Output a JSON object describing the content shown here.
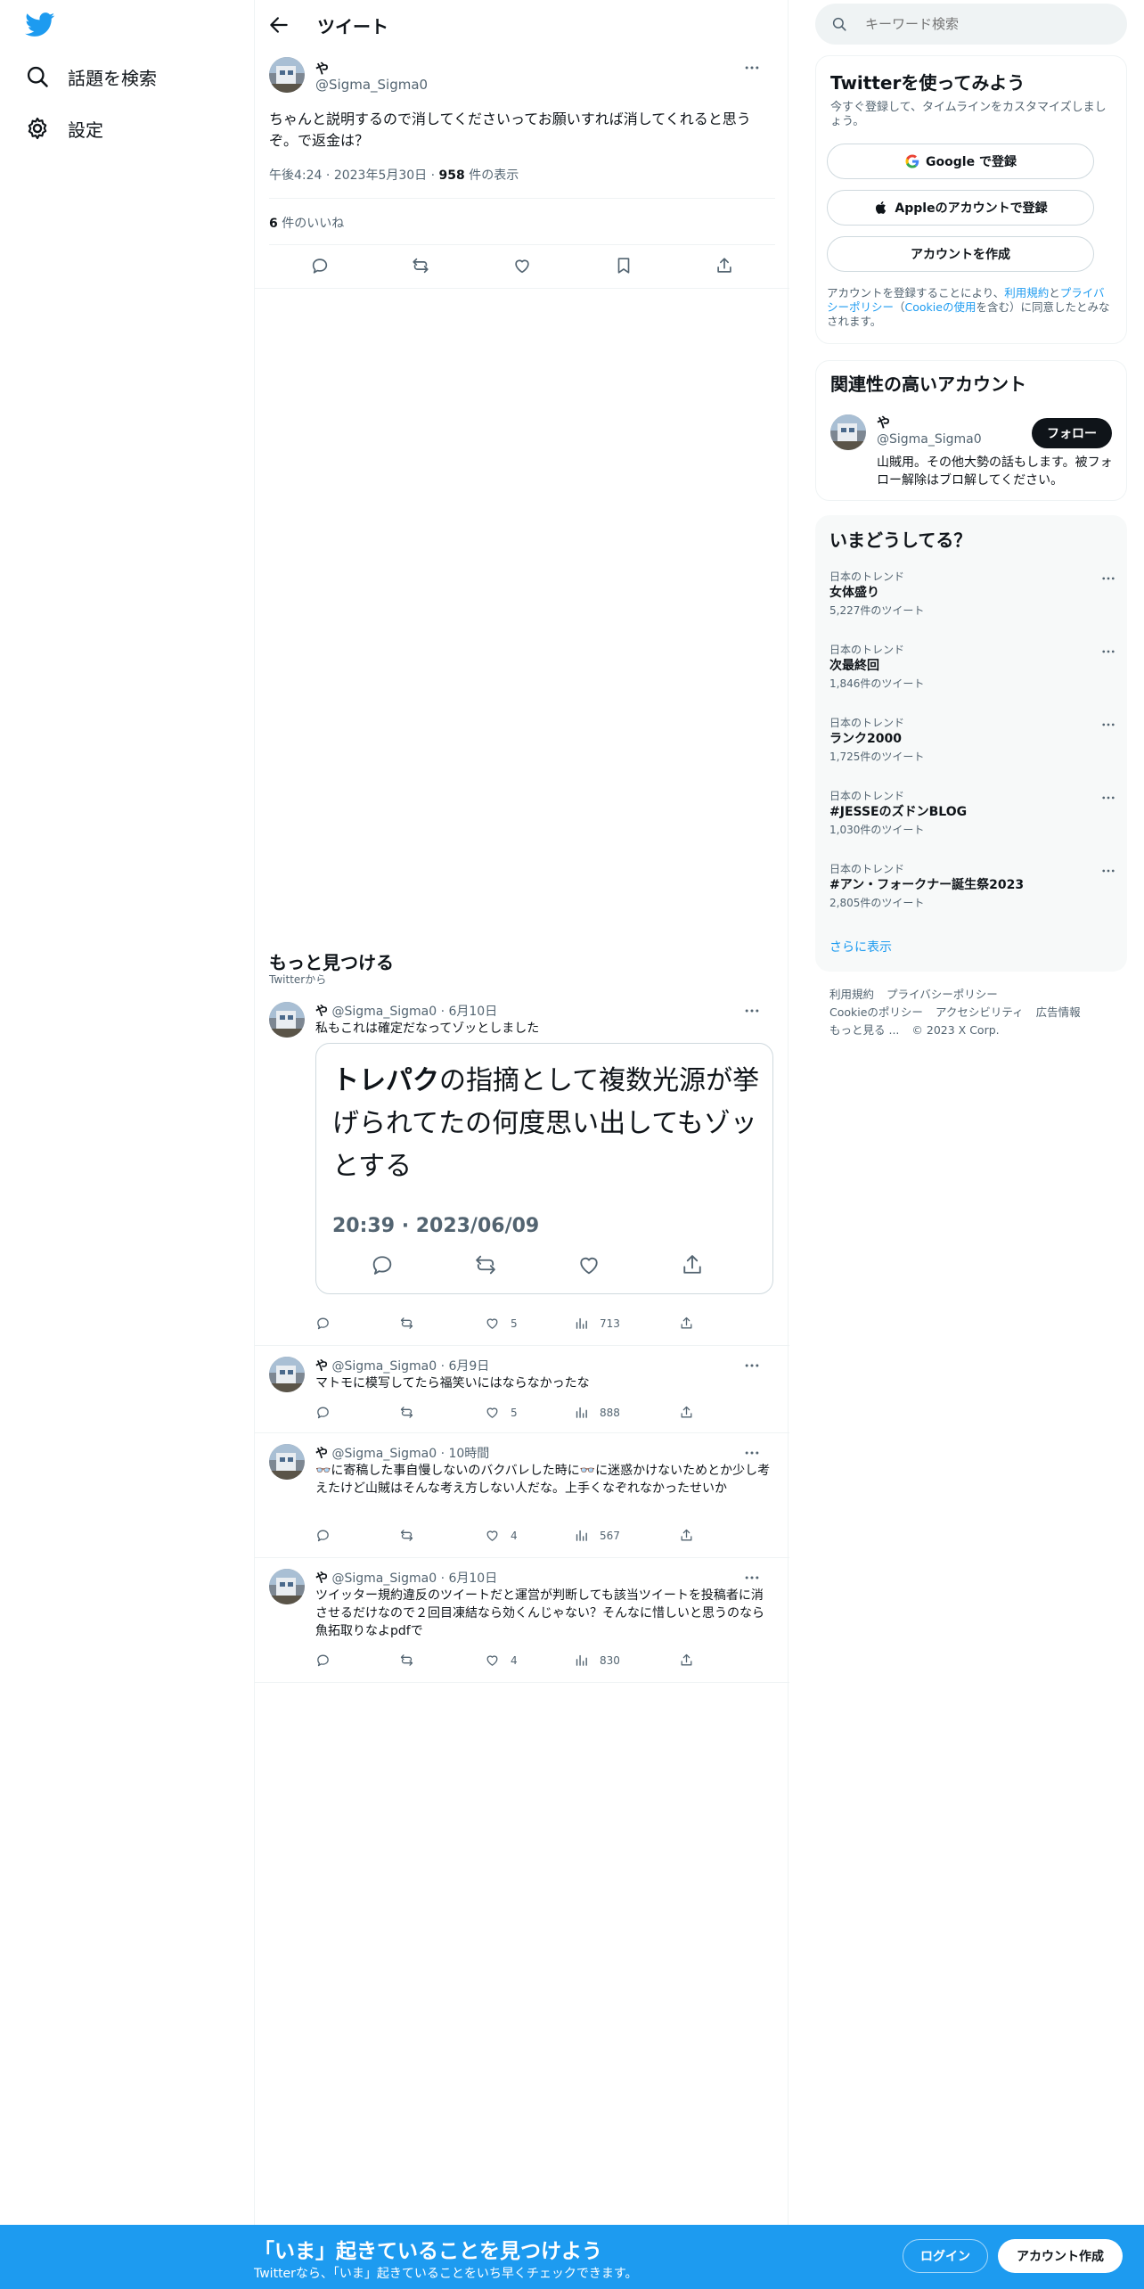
{
  "nav": {
    "items": [
      {
        "label": "話題を検索",
        "icon": "search-icon"
      },
      {
        "label": "設定",
        "icon": "gear-icon"
      }
    ]
  },
  "header": {
    "title": "ツイート"
  },
  "main_tweet": {
    "name": "や",
    "handle": "@Sigma_Sigma0",
    "text": "ちゃんと説明するので消してくださいってお願いすれば消してくれると思うぞ。で返金は？",
    "time": "午後4:24",
    "date": "2023年5月30日",
    "views_count": "958",
    "views_label": "件の表示",
    "likes_count": "6",
    "likes_label": "件のいいね"
  },
  "discover": {
    "title": "もっと見つける",
    "subtitle": "Twitterから"
  },
  "tweets": [
    {
      "name": "や",
      "handle": "@Sigma_Sigma0",
      "date": "6月10日",
      "text": "私もこれは確定だなってゾッとしました",
      "quote": {
        "bold": "トレパク",
        "rest": "の指摘として複数光源が挙げられてたの何度思い出してもゾッとする",
        "time": "20:39 · 2023/06/09"
      },
      "likes": "5",
      "views": "713"
    },
    {
      "name": "や",
      "handle": "@Sigma_Sigma0",
      "date": "6月9日",
      "text": "マトモに模写してたら福笑いにはならなかったな",
      "likes": "5",
      "views": "888"
    },
    {
      "name": "や",
      "handle": "@Sigma_Sigma0",
      "date": "10時間",
      "text": "👓に寄稿した事自慢しないのバクバレした時に👓に迷惑かけないためとか少し考えたけど山賊はそんな考え方しない人だな。上手くなぞれなかったせいか",
      "likes": "4",
      "views": "567"
    },
    {
      "name": "や",
      "handle": "@Sigma_Sigma0",
      "date": "6月10日",
      "text": "ツイッター規約違反のツイートだと運営が判断しても該当ツイートを投稿者に消させるだけなので２回目凍結なら効くんじゃない？そんなに惜しいと思うのなら魚拓取りなよpdfで",
      "likes": "4",
      "views": "830"
    }
  ],
  "search": {
    "placeholder": "キーワード検索"
  },
  "signup": {
    "title": "Twitterを使ってみよう",
    "subtitle": "今すぐ登録して、タイムラインをカスタマイズしましょう。",
    "google": "Google で登録",
    "apple": "Appleのアカウントで登録",
    "create": "アカウントを作成",
    "legal_1": "アカウントを登録することにより、",
    "legal_terms": "利用規約",
    "legal_2": "と",
    "legal_privacy": "プライバシーポリシー",
    "legal_3": "（",
    "legal_cookie": "Cookieの使用",
    "legal_4": "を含む）に同意したとみなされます。"
  },
  "related": {
    "title": "関連性の高いアカウント",
    "name": "や",
    "handle": "@Sigma_Sigma0",
    "follow": "フォロー",
    "bio": "山賊用。その他大勢の話もします。被フォロー解除はブロ解してください。"
  },
  "trends": {
    "title": "いまどうしてる？",
    "items": [
      {
        "category": "日本のトレンド",
        "name": "女体盛り",
        "count": "5,227件のツイート"
      },
      {
        "category": "日本のトレンド",
        "name": "次最終回",
        "count": "1,846件のツイート"
      },
      {
        "category": "日本のトレンド",
        "name": "ランク2000",
        "count": "1,725件のツイート"
      },
      {
        "category": "日本のトレンド",
        "name": "#JESSEのズドンBLOG",
        "count": "1,030件のツイート"
      },
      {
        "category": "日本のトレンド",
        "name": "#アン・フォークナー誕生祭2023",
        "count": "2,805件のツイート"
      }
    ],
    "show_more": "さらに表示"
  },
  "footer": {
    "terms": "利用規約",
    "privacy": "プライバシーポリシー",
    "cookie": "Cookieのポリシー",
    "accessibility": "アクセシビリティ",
    "ads": "広告情報",
    "more": "もっと見る ...",
    "copyright": "© 2023 X Corp."
  },
  "bottom_bar": {
    "title": "「いま」起きていることを見つけよう",
    "subtitle": "Twitterなら、「いま」起きていることをいち早くチェックできます。",
    "login": "ログイン",
    "signup": "アカウント作成"
  },
  "colors": {
    "brand": "#1d9bf0",
    "text": "#0f1419",
    "secondary": "#536471"
  }
}
